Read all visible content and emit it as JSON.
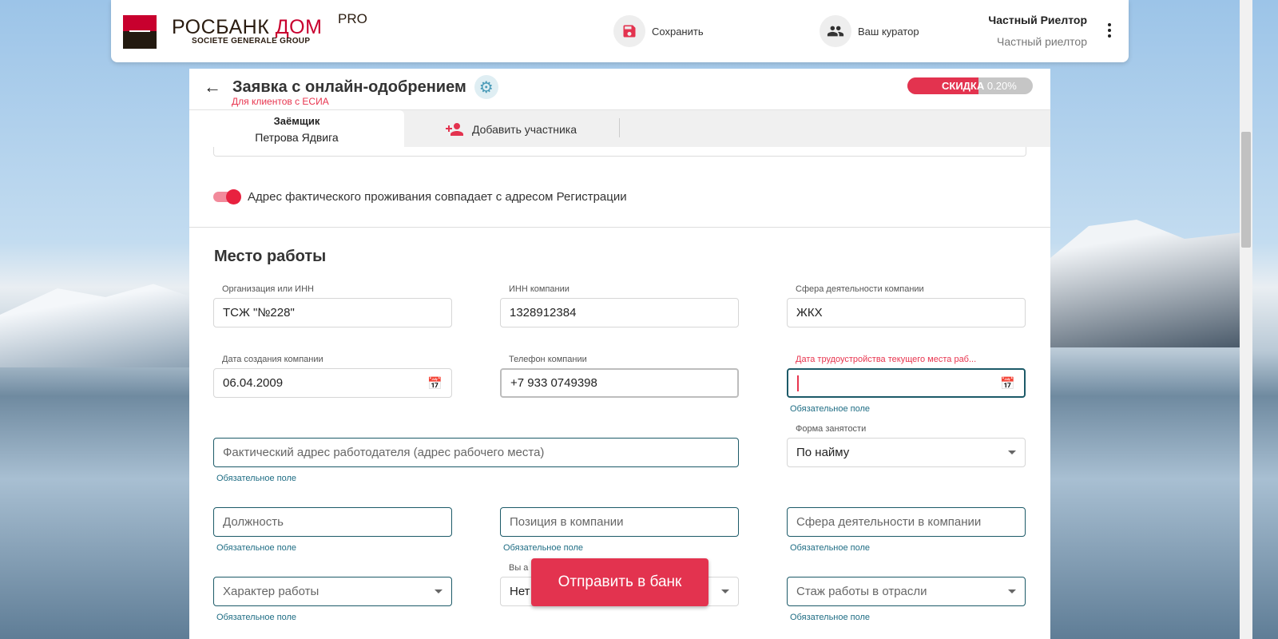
{
  "header": {
    "logo_main": "РОСБАНК",
    "logo_accent": "ДОМ",
    "logo_pro": "PRO",
    "logo_sub": "SOCIETE GENERALE GROUP",
    "save_label": "Сохранить",
    "curator_label": "Ваш куратор",
    "user_name": "Частный Риелтор",
    "user_role": "Частный риелтор"
  },
  "page": {
    "title": "Заявка с онлайн-одобрением",
    "subtitle": "Для клиентов с ЕСИА",
    "discount_label": "СКИДКА",
    "discount_value": "0.20%",
    "discount_fill_fraction": 0.57
  },
  "tabs": {
    "active_role": "Заёмщик",
    "active_name": "Петрова Ядвига",
    "add_label": "Добавить участника"
  },
  "toggle": {
    "label": "Адрес фактического проживания совпадает с адресом Регистрации",
    "on": true
  },
  "section": {
    "title": "Место работы"
  },
  "fields": {
    "org": {
      "label": "Организация или ИНН",
      "value": "ТСЖ \"№228\""
    },
    "inn": {
      "label": "ИНН компании",
      "value": "1328912384"
    },
    "sphere": {
      "label": "Сфера деятельности компании",
      "value": "ЖКХ"
    },
    "created": {
      "label": "Дата создания компании",
      "value": "06.04.2009"
    },
    "phone": {
      "label": "Телефон компании",
      "value": "+7 933 0749398"
    },
    "hired": {
      "label": "Дата трудоустройства текущего места раб...",
      "helper": "Обязательное поле"
    },
    "address": {
      "placeholder": "Фактический адрес работодателя (адрес рабочего места)",
      "helper": "Обязательное поле"
    },
    "employment": {
      "label": "Форма занятости",
      "value": "По найму"
    },
    "position": {
      "placeholder": "Должность",
      "helper": "Обязательное поле"
    },
    "company_position": {
      "placeholder": "Позиция в компании",
      "helper": "Обязательное поле"
    },
    "company_sphere": {
      "placeholder": "Сфера деятельности в компании",
      "helper": "Обязательное поле"
    },
    "work_type": {
      "placeholder": "Характер работы",
      "helper": "Обязательное поле"
    },
    "affiliate": {
      "label": "Вы а",
      "value": "Нет"
    },
    "experience": {
      "placeholder": "Стаж работы в отрасли",
      "helper": "Обязательное поле"
    }
  },
  "send_label": "Отправить в банк"
}
